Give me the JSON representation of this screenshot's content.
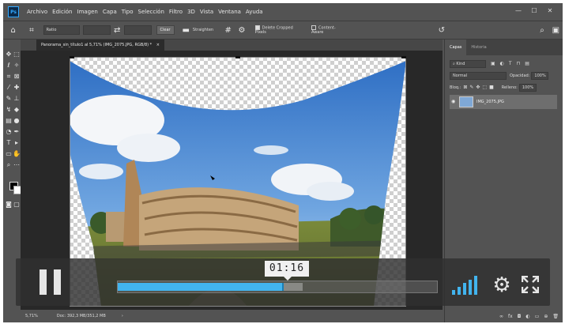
{
  "menubar": {
    "logo": "Ps",
    "items": [
      "Archivo",
      "Edición",
      "Imagen",
      "Capa",
      "Tipo",
      "Selección",
      "Filtro",
      "3D",
      "Vista",
      "Ventana",
      "Ayuda"
    ],
    "window_controls": [
      "—",
      "☐",
      "✕"
    ]
  },
  "options": {
    "ratio_label": "Ratio",
    "clear_label": "Clear",
    "straighten_label": "Straighten",
    "delete_cropped": "Delete Cropped Pixels",
    "content_aware": "Content-Aware"
  },
  "document": {
    "tab_title": "Panorama_sin_título1 al 5,71% (IMG_2075.JPG, RGB/8) *",
    "tab_close": "×"
  },
  "status": {
    "zoom": "5,71%",
    "doc_info": "Doc: 392,3 MB/351,2 MB",
    "arrow": "›"
  },
  "layers_panel": {
    "tabs": [
      "Capas",
      "Historia"
    ],
    "kind_label": "Kind",
    "blend_mode": "Normal",
    "opacity_label": "Opacidad:",
    "opacity_value": "100%",
    "lock_label": "Bloq.:",
    "fill_label": "Relleno:",
    "fill_value": "100%",
    "layer_name": "IMG_2075.JPG",
    "bottom_icons": [
      "fx",
      "◘",
      "◐",
      "▭",
      "⊕",
      "🗑"
    ]
  },
  "video_player": {
    "time": "01:16",
    "progress": 0.52,
    "buffered": 0.58,
    "volume_level": 5,
    "volume_max": 5,
    "accent": "#42b4ee"
  }
}
